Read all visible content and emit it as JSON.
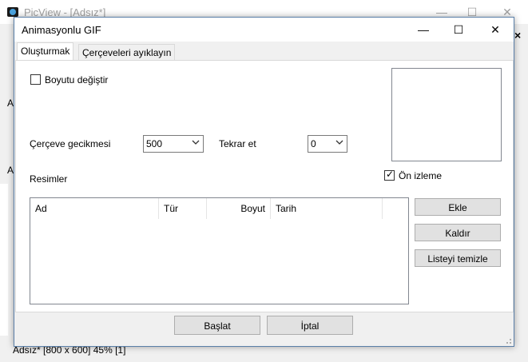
{
  "bg_window": {
    "title": "PicView - [Adsız*]",
    "minimize": "—",
    "maximize": "☐",
    "close": "✕",
    "left_label_a1": "A",
    "left_label_a2": "A",
    "status_bar": "Adsız* [800 x 600] 45% [1]",
    "close_x": "×"
  },
  "dialog": {
    "title": "Animasyonlu GIF",
    "minimize": "—",
    "maximize": "☐",
    "close": "✕",
    "tabs": [
      {
        "label": "Oluşturmak",
        "active": true
      },
      {
        "label": "Çerçeveleri ayıklayın",
        "active": false
      }
    ],
    "resize_checkbox_label": "Boyutu değiştir",
    "frame_delay_label": "Çerçeve gecikmesi",
    "frame_delay_value": "500",
    "repeat_label": "Tekrar et",
    "repeat_value": "0",
    "images_label": "Resimler",
    "preview_checkbox_label": "Ön izleme",
    "preview_checked": true,
    "columns": [
      "Ad",
      "Tür",
      "Boyut",
      "Tarih"
    ],
    "buttons": {
      "add": "Ekle",
      "remove": "Kaldır",
      "clear_list": "Listeyi temizle",
      "start": "Başlat",
      "cancel": "İptal"
    }
  }
}
